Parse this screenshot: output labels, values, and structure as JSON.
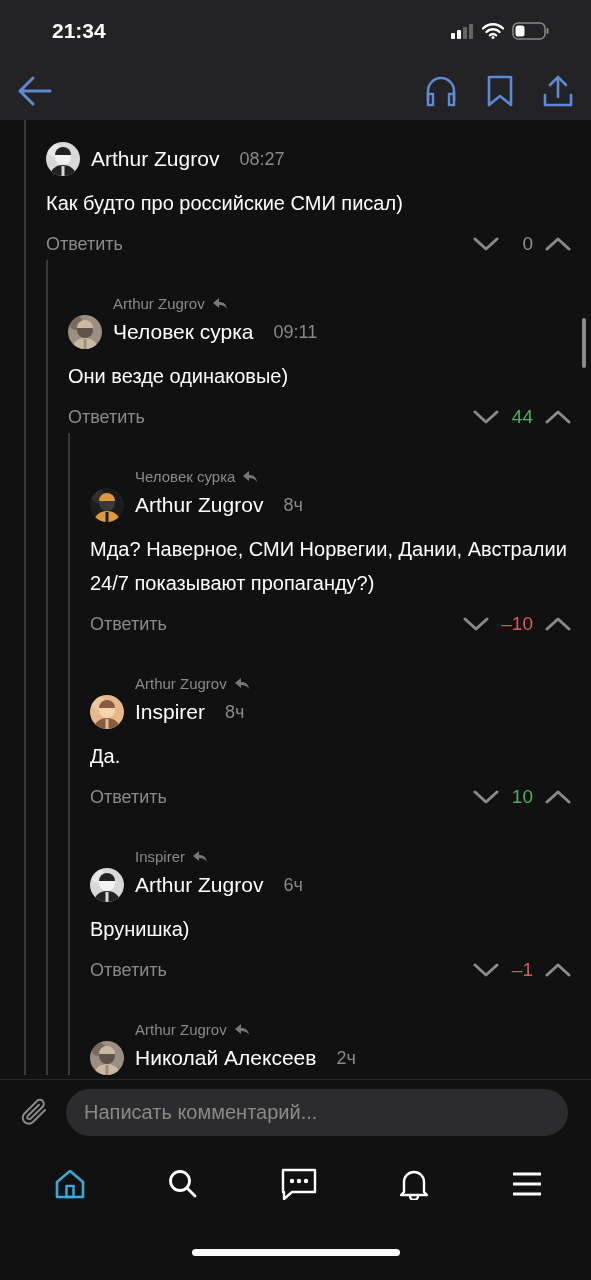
{
  "status_bar": {
    "time": "21:34"
  },
  "comments": [
    {
      "author": "Arthur Zugrov",
      "time": "08:27",
      "text": "Как будто про российские СМИ писал)",
      "reply_label": "Ответить",
      "score": "0",
      "color": "#8e8e93",
      "children": [
        {
          "reply_to": "Arthur Zugrov",
          "author": "Человек сурка",
          "time": "09:11",
          "text": "Они везде одинаковые)",
          "reply_label": "Ответить",
          "score": "44",
          "color": "#4cb05e",
          "children": [
            {
              "reply_to": "Человек сурка",
              "author": "Arthur Zugrov",
              "time": "8ч",
              "text": "Мда? Наверное, СМИ Норвегии, Дании, Австралии 24/7 показывают пропаганду?)",
              "reply_label": "Ответить",
              "score": "–10",
              "color": "#d95b5b"
            },
            {
              "reply_to": "Arthur Zugrov",
              "author": "Inspirer",
              "time": "8ч",
              "text": "Да.",
              "reply_label": "Ответить",
              "score": "10",
              "color": "#4cb05e"
            },
            {
              "reply_to": "Inspirer",
              "author": "Arthur Zugrov",
              "time": "6ч",
              "text": "Врунишка)",
              "reply_label": "Ответить",
              "score": "–1",
              "color": "#d95b5b"
            },
            {
              "reply_to": "Arthur Zugrov",
              "author": "Николай Алексеев",
              "time": "2ч"
            }
          ]
        }
      ]
    }
  ],
  "composer": {
    "placeholder": "Написать комментарий..."
  },
  "tab_bar": [
    {
      "kind": "home",
      "selected": true
    },
    {
      "kind": "search",
      "selected": false
    },
    {
      "kind": "messages",
      "selected": false
    },
    {
      "kind": "notifications",
      "selected": false
    },
    {
      "kind": "menu",
      "selected": false
    }
  ]
}
